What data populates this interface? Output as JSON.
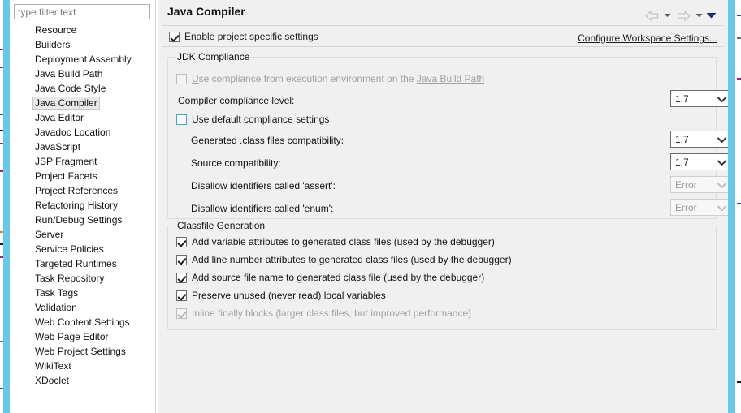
{
  "window": {
    "accent_color": "#68c8ea",
    "panel_bg": "#f0f0f0"
  },
  "sidebar": {
    "filter": {
      "value": "",
      "placeholder": "type filter text"
    },
    "selected": "Java Compiler",
    "items": [
      {
        "label": "Resource"
      },
      {
        "label": "Builders"
      },
      {
        "label": "Deployment Assembly"
      },
      {
        "label": "Java Build Path"
      },
      {
        "label": "Java Code Style"
      },
      {
        "label": "Java Compiler"
      },
      {
        "label": "Java Editor"
      },
      {
        "label": "Javadoc Location"
      },
      {
        "label": "JavaScript"
      },
      {
        "label": "JSP Fragment"
      },
      {
        "label": "Project Facets"
      },
      {
        "label": "Project References"
      },
      {
        "label": "Refactoring History"
      },
      {
        "label": "Run/Debug Settings"
      },
      {
        "label": "Server"
      },
      {
        "label": "Service Policies"
      },
      {
        "label": "Targeted Runtimes"
      },
      {
        "label": "Task Repository"
      },
      {
        "label": "Task Tags"
      },
      {
        "label": "Validation"
      },
      {
        "label": "Web Content Settings"
      },
      {
        "label": "Web Page Editor"
      },
      {
        "label": "Web Project Settings"
      },
      {
        "label": "WikiText"
      },
      {
        "label": "XDoclet"
      }
    ]
  },
  "header": {
    "title": "Java Compiler",
    "back_icon": "back-arrow-icon",
    "back_menu_icon": "chevron-down-icon",
    "forward_icon": "forward-arrow-icon",
    "forward_menu_icon": "chevron-down-icon",
    "view_menu_icon": "chevron-down-icon"
  },
  "enable_project_specific": {
    "label": "Enable project specific settings",
    "checked": true
  },
  "configure_workspace_link": "Configure Workspace Settings...",
  "jdk_compliance": {
    "title": "JDK Compliance",
    "use_execution_env": {
      "label_prefix": "Use compliance from execution environment on the ",
      "label_link": "Java Build Path",
      "checked": false,
      "enabled": false
    },
    "compiler_compliance_level": {
      "label": "Compiler compliance level:",
      "value": "1.7",
      "enabled": true
    },
    "use_default_compliance": {
      "label": "Use default compliance settings",
      "checked": false,
      "enabled": true
    },
    "generated_class_files": {
      "label": "Generated .class files compatibility:",
      "value": "1.7",
      "enabled": true
    },
    "source_compatibility": {
      "label": "Source compatibility:",
      "value": "1.7",
      "enabled": true
    },
    "disallow_assert": {
      "label": "Disallow identifiers called 'assert':",
      "value": "Error",
      "enabled": false
    },
    "disallow_enum": {
      "label": "Disallow identifiers called 'enum':",
      "value": "Error",
      "enabled": false
    }
  },
  "classfile_generation": {
    "title": "Classfile Generation",
    "options": [
      {
        "label": "Add variable attributes to generated class files (used by the debugger)",
        "checked": true,
        "enabled": true
      },
      {
        "label": "Add line number attributes to generated class files (used by the debugger)",
        "checked": true,
        "enabled": true
      },
      {
        "label": "Add source file name to generated class file (used by the debugger)",
        "checked": true,
        "enabled": true
      },
      {
        "label": "Preserve unused (never read) local variables",
        "checked": true,
        "enabled": true
      },
      {
        "label": "Inline finally blocks (larger class files, but improved performance)",
        "checked": true,
        "enabled": false
      }
    ]
  }
}
